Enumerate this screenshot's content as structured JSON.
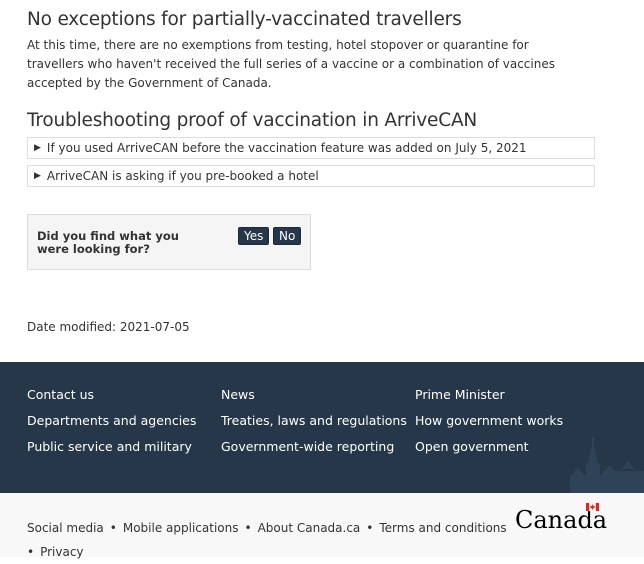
{
  "content": {
    "exceptions_heading": "No exceptions for partially-vaccinated travellers",
    "exceptions_text": "At this time, there are no exemptions from testing, hotel stopover or quarantine for travellers who haven't received the full series of a vaccine or a combination of vaccines accepted by the Government of Canada.",
    "troubleshooting_heading": "Troubleshooting proof of vaccination in ArriveCAN",
    "details": [
      "If you used ArriveCAN before the vaccination feature was added on July 5, 2021",
      "ArriveCAN is asking if you pre-booked a hotel"
    ]
  },
  "feedback": {
    "question": "Did you find what you were looking for?",
    "yes_label": "Yes",
    "no_label": "No"
  },
  "date_modified": "Date modified: 2021-07-05",
  "footer": {
    "col1": [
      "Contact us",
      "Departments and agencies",
      "Public service and military"
    ],
    "col2": [
      "News",
      "Treaties, laws and regulations",
      "Government-wide reporting"
    ],
    "col3": [
      "Prime Minister",
      "How government works",
      "Open government"
    ]
  },
  "subfooter": {
    "links": [
      "Social media",
      "Mobile applications",
      "About Canada.ca",
      "Terms and conditions",
      "Privacy"
    ],
    "separator": "•",
    "wordmark": "Canada"
  },
  "colors": {
    "footer_bg": "#26374a",
    "button_bg": "#26374a",
    "flag_red": "#d52b1e"
  }
}
